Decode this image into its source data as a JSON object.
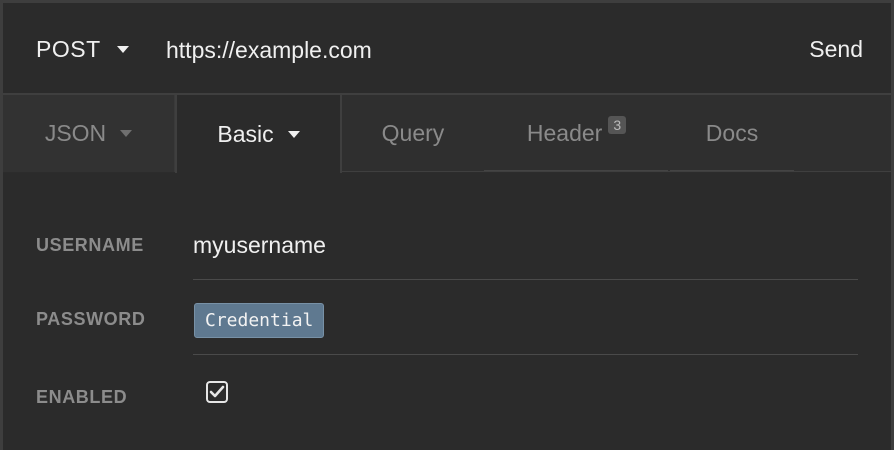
{
  "request": {
    "method": "POST",
    "url": "https://example.com",
    "send_label": "Send"
  },
  "tabs": [
    {
      "label": "JSON"
    },
    {
      "label": "Basic"
    },
    {
      "label": "Query"
    },
    {
      "label": "Header",
      "badge": "3"
    },
    {
      "label": "Docs"
    }
  ],
  "form": {
    "username_label": "USERNAME",
    "username_value": "myusername",
    "password_label": "PASSWORD",
    "password_value": "Credential",
    "enabled_label": "ENABLED",
    "enabled_checked": true
  },
  "colors": {
    "background": "#2b2b2b",
    "credential_chip": "#5f7990"
  }
}
